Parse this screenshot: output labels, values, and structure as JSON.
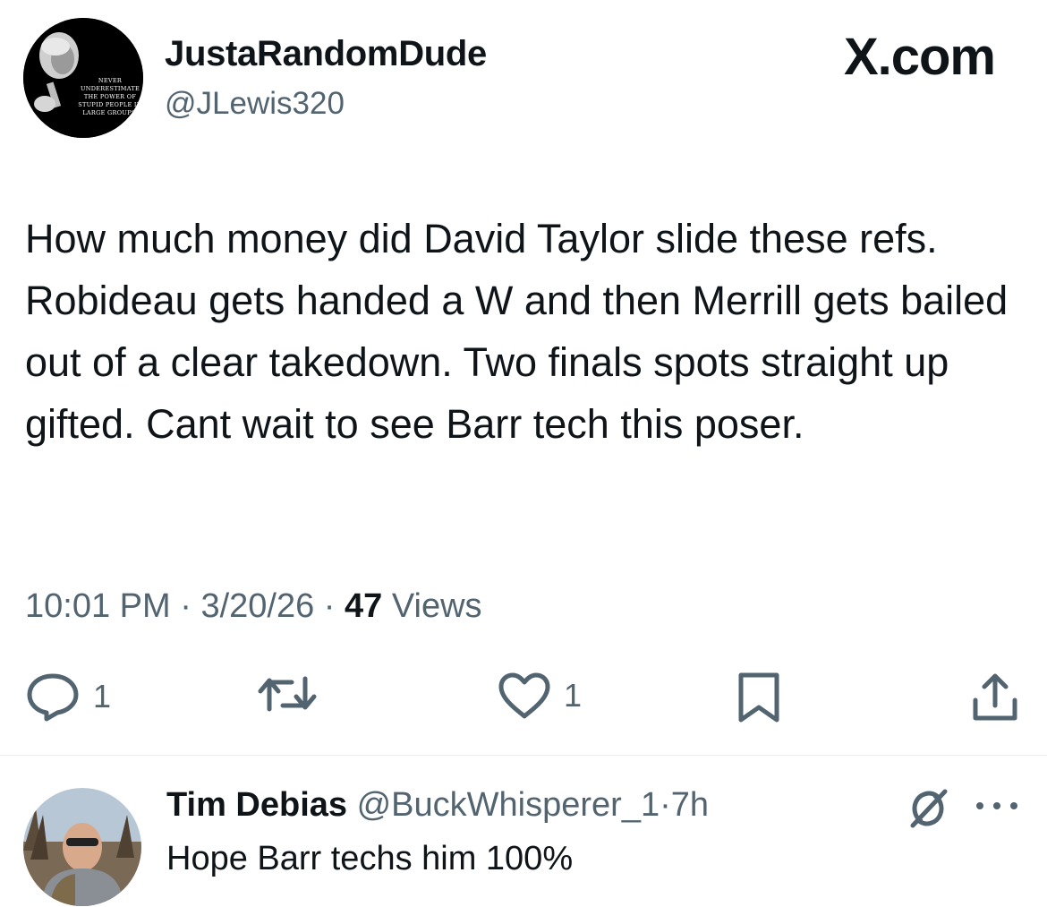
{
  "post": {
    "author": {
      "display_name": "JustaRandomDude",
      "handle": "@JLewis320",
      "avatar_quote": "Never underestimate the power of stupid people in large groups."
    },
    "brand": "X.com",
    "text": "How much money did David Taylor slide these refs. Robideau gets handed a W and then Merrill gets bailed out of a clear takedown. Two finals spots straight up gifted. Cant wait to see Barr tech this poser.",
    "time": "10:01 PM",
    "date": "3/20/26",
    "separator": "·",
    "views_count": "47",
    "views_label": "Views",
    "actions": {
      "reply_count": "1",
      "like_count": "1"
    }
  },
  "reply": {
    "name": "Tim Debias",
    "handle": "@BuckWhisperer_1",
    "separator": "·",
    "time": "7h",
    "text": "Hope Barr techs him 100%"
  },
  "colors": {
    "primary_text": "#0f1419",
    "secondary_text": "#536471",
    "divider": "#e6ecf0"
  },
  "icons": [
    "reply-icon",
    "repost-icon",
    "like-icon",
    "bookmark-icon",
    "share-icon",
    "grok-icon",
    "more-icon"
  ]
}
